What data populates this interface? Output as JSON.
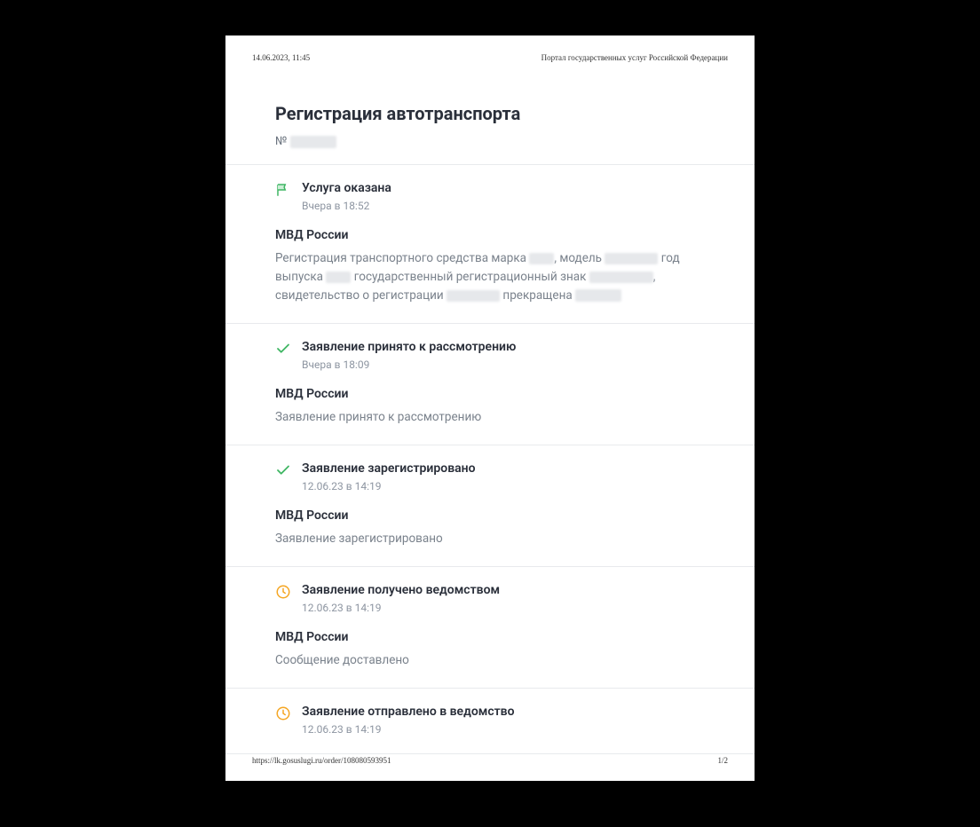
{
  "print": {
    "timestamp": "14.06.2023, 11:45",
    "portal_title": "Портал государственных услуг Российской Федерации",
    "url": "https://lk.gosuslugi.ru/order/108080593951",
    "page_indicator": "1/2"
  },
  "header": {
    "title": "Регистрация автотранспорта",
    "order_prefix": "№"
  },
  "statuses": [
    {
      "icon": "flag",
      "title": "Услуга оказана",
      "time": "Вчера в 18:52",
      "agency": "МВД России",
      "body_type": "vehicle_desc",
      "body_parts": {
        "p1": "Регистрация транспортного средства марка ",
        "p2": ", модель ",
        "p3": " год выпуска ",
        "p4": " государственный регистрационный знак ",
        "p5": ", свидетельство о регистрации ",
        "p6": " прекращена "
      }
    },
    {
      "icon": "check",
      "title": "Заявление принято к рассмотрению",
      "time": "Вчера в 18:09",
      "agency": "МВД России",
      "body_text": "Заявление принято к рассмотрению"
    },
    {
      "icon": "check",
      "title": "Заявление зарегистрировано",
      "time": "12.06.23 в 14:19",
      "agency": "МВД России",
      "body_text": "Заявление зарегистрировано"
    },
    {
      "icon": "clock",
      "title": "Заявление получено ведомством",
      "time": "12.06.23 в 14:19",
      "agency": "МВД России",
      "body_text": "Сообщение доставлено"
    },
    {
      "icon": "clock",
      "title": "Заявление отправлено в ведомство",
      "time": "12.06.23 в 14:19"
    }
  ]
}
